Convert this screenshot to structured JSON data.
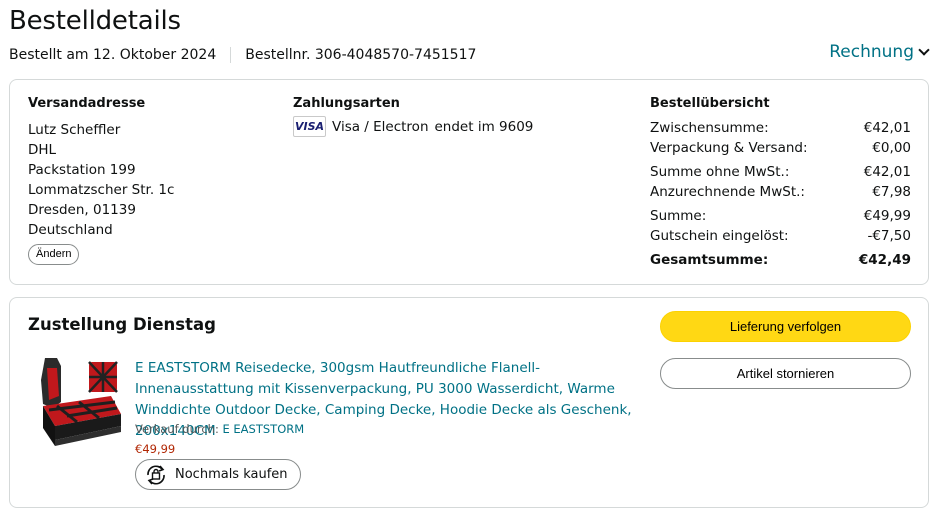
{
  "page": {
    "title": "Bestelldetails",
    "order_date": "Bestellt am 12. Oktober 2024",
    "order_number": "Bestellnr. 306-4048570-7451517",
    "invoice_label": "Rechnung"
  },
  "shipping": {
    "heading": "Versandadresse",
    "lines": [
      "Lutz Scheffler",
      "DHL",
      "Packstation 199",
      "Lommatzscher Str. 1c",
      "Dresden, 01139",
      "Deutschland"
    ],
    "change_label": "Ändern"
  },
  "payment": {
    "heading": "Zahlungsarten",
    "card_brand": "VISA",
    "card_text": "Visa / Electron",
    "card_ending": "endet im 9609"
  },
  "summary": {
    "heading": "Bestellübersicht",
    "rows": [
      {
        "label": "Zwischensumme:",
        "value": "€42,01"
      },
      {
        "label": "Verpackung & Versand:",
        "value": "€0,00"
      },
      {
        "label": "Summe ohne MwSt.:",
        "value": "€42,01"
      },
      {
        "label": "Anzurechnende MwSt.:",
        "value": "€7,98"
      },
      {
        "label": "Summe:",
        "value": "€49,99"
      },
      {
        "label": "Gutschein eingelöst:",
        "value": "-€7,50"
      },
      {
        "label": "Gesamtsumme:",
        "value": "€42,49"
      }
    ]
  },
  "delivery": {
    "title": "Zustellung Dienstag",
    "track_label": "Lieferung verfolgen",
    "cancel_label": "Artikel stornieren",
    "item": {
      "title": "E EASTSTORM Reisedecke, 300gsm Hautfreundliche Flanell-Innenausstattung mit Kissenverpackung, PU 3000 Wasserdicht, Warme Winddichte Outdoor Decke, Camping Decke, Hoodie Decke als Geschenk, 200x140CM",
      "sold_by_label": "Verkauf durch:",
      "seller": "E EASTSTORM",
      "price": "€49,99",
      "rebuy_label": "Nochmals kaufen"
    }
  },
  "colors": {
    "link": "#007185",
    "primary_button": "#FFD814",
    "price": "#B12704",
    "border": "#D5D9D9"
  },
  "icons": {
    "invoice": "chevron-down-icon",
    "card": "visa-card-icon",
    "rebuy": "buy-again-icon"
  }
}
